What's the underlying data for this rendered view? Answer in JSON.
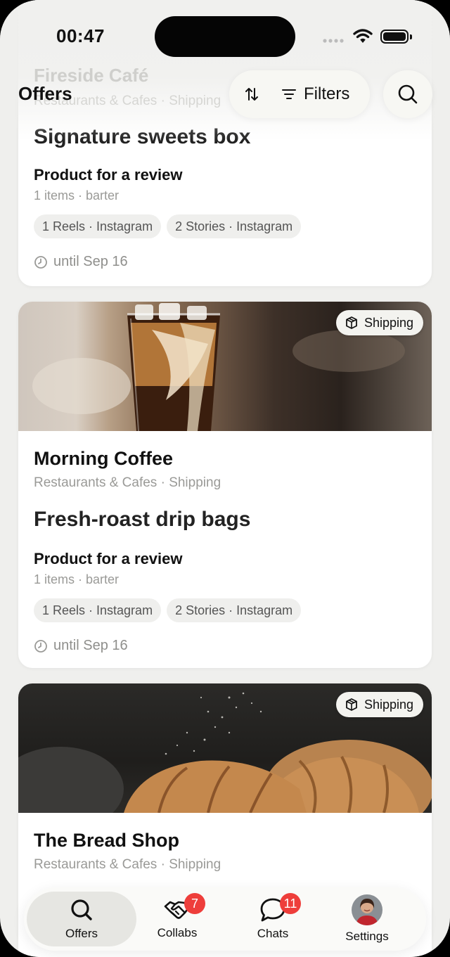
{
  "status_bar": {
    "time": "00:47"
  },
  "header": {
    "title": "Offers",
    "filters_label": "Filters",
    "ghost_business": "Fireside Café",
    "ghost_category": "Restaurants & Cafes · Shipping"
  },
  "cards": [
    {
      "offer_title": "Signature sweets box",
      "offer_type": "Product for a review",
      "items": "1 items · barter",
      "chips": [
        "1 Reels · Instagram",
        "2 Stories · Instagram"
      ],
      "until": "until Sep 16"
    },
    {
      "badge": "Shipping",
      "business": "Morning Coffee",
      "category": "Restaurants & Cafes · Shipping",
      "offer_title": "Fresh-roast drip bags",
      "offer_type": "Product for a review",
      "items": "1 items · barter",
      "chips": [
        "1 Reels · Instagram",
        "2 Stories · Instagram"
      ],
      "until": "until Sep 16"
    },
    {
      "badge": "Shipping",
      "business": "The Bread Shop",
      "category": "Restaurants & Cafes · Shipping"
    }
  ],
  "tabbar": {
    "tabs": [
      {
        "label": "Offers",
        "icon": "search-icon",
        "active": true
      },
      {
        "label": "Collabs",
        "icon": "handshake-icon",
        "badge": "7"
      },
      {
        "label": "Chats",
        "icon": "chat-bubble-icon",
        "badge": "11"
      },
      {
        "label": "Settings",
        "icon": "avatar"
      }
    ]
  },
  "colors": {
    "badge": "#ee3e3b",
    "background": "#efefed",
    "card": "#ffffff"
  }
}
